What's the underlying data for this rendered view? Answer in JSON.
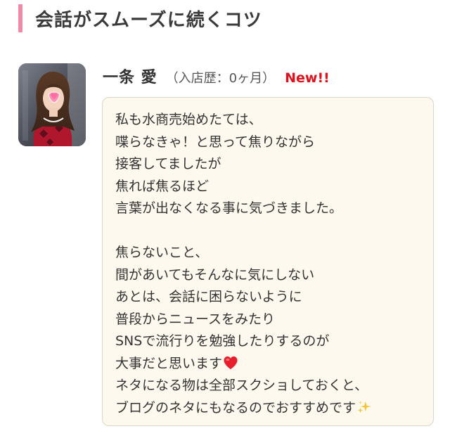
{
  "section": {
    "title": "会話がスムーズに続くコツ",
    "accent_color": "#f08aa8"
  },
  "author": {
    "name": "一条 愛",
    "tenure": "（入店歴：0ヶ月）",
    "badge": "New!!",
    "badge_color": "#e0101c",
    "avatar_icon": "profile-photo"
  },
  "post": {
    "background": "#fdf9ee",
    "lines": [
      "私も水商売始めたては、",
      "喋らなきゃ！と思って焦りながら",
      "接客してましたが",
      "焦れば焦るほど",
      "言葉が出なくなる事に気づきました。",
      "",
      "焦らないこと、",
      "間があいてもそんなに気にしない",
      "あとは、会話に困らないように",
      "普段からニュースをみたり",
      "SNSで流行りを勉強したりするのが",
      "大事だと思います",
      "ネタになる物は全部スクショしておくと、",
      "ブログのネタにもなるのでおすすめです"
    ],
    "emojis": {
      "line_11": "red-heart-icon",
      "line_13": "sparkles-icon"
    }
  }
}
